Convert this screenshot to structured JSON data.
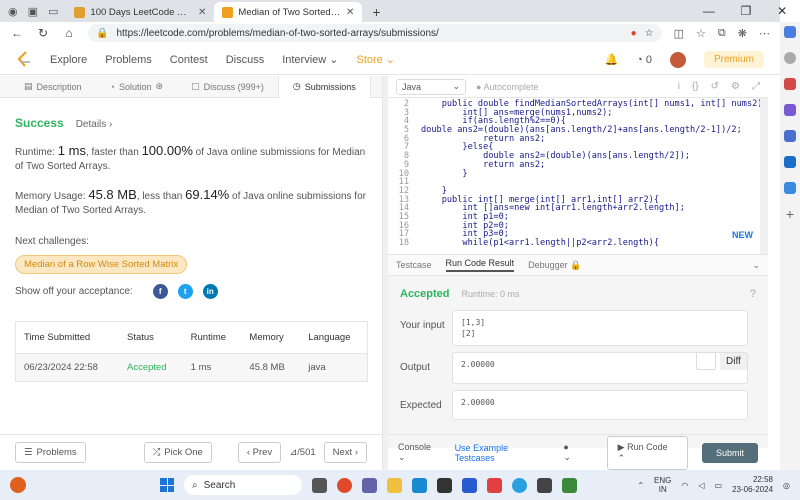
{
  "browser": {
    "tabs": [
      {
        "title": "100 Days LeetCode Challenge - ",
        "active": false,
        "favicon_color": "#e0a030"
      },
      {
        "title": "Median of Two Sorted Arrays - L",
        "active": true,
        "favicon_color": "#f0a020"
      }
    ],
    "new_tab": "+",
    "url": "https://leetcode.com/problems/median-of-two-sorted-arrays/submissions/",
    "window_controls": [
      "—",
      "❐",
      "✕"
    ]
  },
  "nav": {
    "items": [
      "Explore",
      "Problems",
      "Contest",
      "Discuss",
      "Interview ⌄",
      "Store ⌄"
    ],
    "notif_count": "0",
    "premium": "Premium"
  },
  "left_tabs": [
    "Description",
    "Solution",
    "Discuss (999+)",
    "Submissions"
  ],
  "submission": {
    "status": "Success",
    "details": "Details ›",
    "runtime_prefix": "Runtime: ",
    "runtime": "1 ms",
    "runtime_mid": ", faster than ",
    "runtime_pct": "100.00%",
    "runtime_suffix": " of Java online submissions for Median of Two Sorted Arrays.",
    "memory_prefix": "Memory Usage: ",
    "memory": "45.8 MB",
    "memory_mid": ", less than ",
    "memory_pct": "69.14%",
    "memory_suffix": " of Java online submissions for Median of Two Sorted Arrays.",
    "next_label": "Next challenges:",
    "next_challenge": "Median of a Row Wise Sorted Matrix",
    "share_label": "Show off your acceptance:"
  },
  "table": {
    "headers": [
      "Time Submitted",
      "Status",
      "Runtime",
      "Memory",
      "Language"
    ],
    "rows": [
      [
        "06/23/2024 22:58",
        "Accepted",
        "1 ms",
        "45.8 MB",
        "java"
      ]
    ]
  },
  "left_footer": {
    "problems": "Problems",
    "pick_one": "Pick One",
    "prev": "‹ Prev",
    "page": "/501",
    "next": "Next ›"
  },
  "editor": {
    "language": "Java",
    "autocomplete": "Autocomplete",
    "lines": [
      {
        "n": "2",
        "t": "    public double findMedianSortedArrays(int[] nums1, int[] nums2) {"
      },
      {
        "n": "3",
        "t": "        int[] ans=merge(nums1,nums2);"
      },
      {
        "n": "4",
        "t": "        if(ans.length%2==0){"
      },
      {
        "n": "5",
        "t": "double ans2=(double)(ans[ans.length/2]+ans[ans.length/2-1])/2;"
      },
      {
        "n": "6",
        "t": "            return ans2;"
      },
      {
        "n": "7",
        "t": "        }else{"
      },
      {
        "n": "8",
        "t": "            double ans2=(double)(ans[ans.length/2]);"
      },
      {
        "n": "9",
        "t": "            return ans2;"
      },
      {
        "n": "10",
        "t": "        }"
      },
      {
        "n": "11",
        "t": ""
      },
      {
        "n": "12",
        "t": "    }"
      },
      {
        "n": "13",
        "t": "    public int[] merge(int[] arr1,int[] arr2){"
      },
      {
        "n": "14",
        "t": "        int []ans=new int[arr1.length+arr2.length];"
      },
      {
        "n": "15",
        "t": "        int p1=0;"
      },
      {
        "n": "16",
        "t": "        int p2=0;"
      },
      {
        "n": "17",
        "t": "        int p3=0;"
      },
      {
        "n": "18",
        "t": "        while(p1<arr1.length||p2<arr2.length){"
      }
    ]
  },
  "result_tabs": [
    "Testcase",
    "Run Code Result",
    "Debugger"
  ],
  "result": {
    "status": "Accepted",
    "runtime": "Runtime: 0 ms",
    "input_label": "Your input",
    "input_line1": "[1,3]",
    "input_line2": "[2]",
    "output_label": "Output",
    "output": "2.00000",
    "diff": "Diff",
    "expected_label": "Expected",
    "expected": "2.00000"
  },
  "right_footer": {
    "console": "Console ⌄",
    "use_example": "Use Example Testcases",
    "run_code": "Run Code ⌃",
    "submit": "Submit"
  },
  "new_badge": "NEW",
  "taskbar": {
    "search": "Search",
    "lang": "ENG",
    "region": "IN",
    "time": "22:58",
    "date": "23-06-2024",
    "notif": "19"
  }
}
